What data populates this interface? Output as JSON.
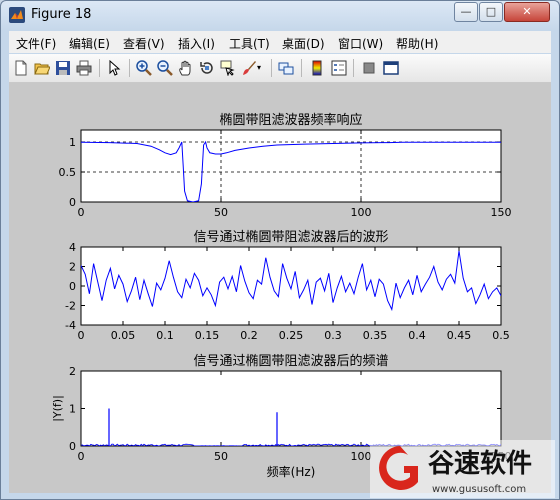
{
  "window": {
    "title": "Figure 18",
    "controls": {
      "minimize": "—",
      "maximize": "□",
      "close": "✕"
    }
  },
  "menubar": {
    "items": [
      {
        "label": "文件(F)"
      },
      {
        "label": "编辑(E)"
      },
      {
        "label": "查看(V)"
      },
      {
        "label": "插入(I)"
      },
      {
        "label": "工具(T)"
      },
      {
        "label": "桌面(D)"
      },
      {
        "label": "窗口(W)"
      },
      {
        "label": "帮助(H)"
      }
    ]
  },
  "toolbar": {
    "icons": [
      "new-figure-icon",
      "open-file-icon",
      "save-icon",
      "print-icon",
      "pointer-icon",
      "zoom-in-icon",
      "zoom-out-icon",
      "pan-hand-icon",
      "rotate-3d-icon",
      "data-cursor-icon",
      "brush-icon",
      "link-plot-icon",
      "colorbar-icon",
      "legend-icon",
      "hide-plot-tools-icon",
      "show-plot-tools-icon"
    ]
  },
  "plot_color": "#0000ff",
  "chart_data": [
    {
      "type": "line",
      "title": "椭圆带阻滤波器频率响应",
      "xlabel": "",
      "ylabel": "",
      "xlim": [
        0,
        150
      ],
      "ylim": [
        0,
        1.2
      ],
      "xticks": [
        "0",
        "50",
        "100",
        "150"
      ],
      "yticks": [
        "0",
        "0.5",
        "1"
      ],
      "dashed_grid_y": [
        0.5,
        1
      ],
      "dashed_grid_x": [
        50,
        100
      ],
      "x": [
        0,
        10,
        20,
        25,
        28,
        30,
        32,
        34,
        35,
        36,
        36.5,
        37,
        38,
        40,
        42,
        43,
        43.8,
        44.5,
        45,
        46,
        48,
        50,
        52,
        55,
        60,
        65,
        70,
        80,
        90,
        100,
        110,
        115,
        130,
        150
      ],
      "y": [
        0.995,
        0.99,
        0.975,
        0.93,
        0.87,
        0.82,
        0.79,
        0.82,
        0.9,
        1.0,
        0.6,
        0.18,
        0.02,
        0.0,
        0.02,
        0.3,
        0.95,
        1.0,
        0.9,
        0.82,
        0.8,
        0.8,
        0.82,
        0.86,
        0.9,
        0.93,
        0.95,
        0.965,
        0.975,
        0.985,
        0.99,
        0.995,
        0.996,
        0.997
      ]
    },
    {
      "type": "line",
      "title": "信号通过椭圆带阻滤波器后的波形",
      "xlabel": "",
      "ylabel": "",
      "xlim": [
        0,
        0.5
      ],
      "ylim": [
        -4,
        4
      ],
      "xticks": [
        "0",
        "0.05",
        "0.1",
        "0.15",
        "0.2",
        "0.25",
        "0.3",
        "0.35",
        "0.4",
        "0.45",
        "0.5"
      ],
      "yticks": [
        "-4",
        "-2",
        "0",
        "2",
        "4"
      ],
      "x": [
        0,
        0.005,
        0.01,
        0.015,
        0.02,
        0.025,
        0.03,
        0.035,
        0.04,
        0.045,
        0.05,
        0.055,
        0.06,
        0.065,
        0.07,
        0.075,
        0.08,
        0.085,
        0.09,
        0.095,
        0.1,
        0.105,
        0.11,
        0.115,
        0.12,
        0.125,
        0.13,
        0.135,
        0.14,
        0.145,
        0.15,
        0.155,
        0.16,
        0.165,
        0.17,
        0.175,
        0.18,
        0.185,
        0.19,
        0.195,
        0.2,
        0.205,
        0.21,
        0.215,
        0.22,
        0.225,
        0.23,
        0.235,
        0.24,
        0.245,
        0.25,
        0.255,
        0.26,
        0.265,
        0.27,
        0.275,
        0.28,
        0.285,
        0.29,
        0.295,
        0.3,
        0.305,
        0.31,
        0.315,
        0.32,
        0.325,
        0.33,
        0.335,
        0.34,
        0.345,
        0.35,
        0.355,
        0.36,
        0.365,
        0.37,
        0.375,
        0.38,
        0.385,
        0.39,
        0.395,
        0.4,
        0.405,
        0.41,
        0.415,
        0.42,
        0.425,
        0.43,
        0.435,
        0.44,
        0.445,
        0.45,
        0.455,
        0.46,
        0.465,
        0.47,
        0.475,
        0.48,
        0.485,
        0.49,
        0.495,
        0.5
      ],
      "y": [
        2.1,
        1.2,
        -0.8,
        2.3,
        0.4,
        -1.5,
        0.6,
        1.8,
        -0.3,
        1.1,
        0.2,
        -1.6,
        -0.5,
        0.9,
        -1.4,
        0.6,
        -0.8,
        -2.1,
        0.3,
        -0.4,
        0.8,
        2.6,
        0.9,
        -0.6,
        -1.2,
        0.7,
        -0.2,
        1.3,
        0.6,
        -1.0,
        -0.2,
        -0.9,
        -2.0,
        0.4,
        0.9,
        -0.3,
        1.0,
        -0.6,
        2.1,
        0.5,
        -0.7,
        -1.3,
        0.6,
        0.2,
        2.9,
        0.9,
        -0.5,
        -1.1,
        2.3,
        0.8,
        -0.3,
        1.5,
        -1.2,
        -0.4,
        0.6,
        -1.9,
        0.4,
        0.8,
        -0.5,
        1.3,
        -1.7,
        -0.2,
        1.0,
        -0.6,
        0.3,
        -0.8,
        0.9,
        2.3,
        -0.4,
        0.6,
        -1.1,
        0.7,
        0.2,
        -1.5,
        -2.4,
        0.3,
        -1.2,
        -0.2,
        0.6,
        -0.9,
        1.1,
        -0.6,
        0.2,
        0.9,
        2.0,
        0.4,
        -0.4,
        0.7,
        1.2,
        0.3,
        3.6,
        0.8,
        -0.6,
        -0.2,
        -1.8,
        -0.9,
        0.2,
        -1.3,
        -0.6,
        -0.2,
        -1.0
      ]
    },
    {
      "type": "line",
      "title": "信号通过椭圆带阻滤波器后的频谱",
      "xlabel": "频率(Hz)",
      "ylabel": "|Y(f)|",
      "xlim": [
        0,
        150
      ],
      "ylim": [
        0,
        2
      ],
      "xticks": [
        "0",
        "50",
        "100",
        "150"
      ],
      "yticks": [
        "0",
        "1",
        "2"
      ],
      "peaks": [
        {
          "x": 10,
          "y": 1.0
        },
        {
          "x": 70,
          "y": 0.9
        }
      ],
      "noise_level": 0.05
    }
  ],
  "watermark": {
    "brand": "谷速软件",
    "url": "www.gususoft.com"
  }
}
